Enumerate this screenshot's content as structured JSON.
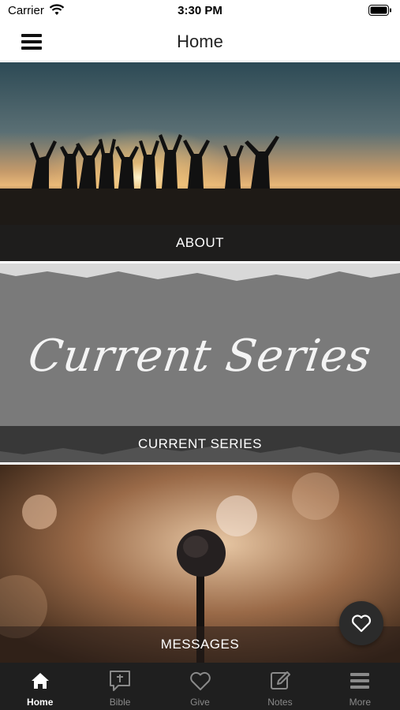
{
  "status_bar": {
    "carrier": "Carrier",
    "time": "3:30 PM"
  },
  "header": {
    "title": "Home"
  },
  "tiles": [
    {
      "label": "ABOUT"
    },
    {
      "label": "CURRENT SERIES",
      "artwork_text": "Current Series"
    },
    {
      "label": "MESSAGES"
    }
  ],
  "tab_bar": {
    "items": [
      {
        "label": "Home",
        "icon": "home-icon",
        "active": true
      },
      {
        "label": "Bible",
        "icon": "bible-icon",
        "active": false
      },
      {
        "label": "Give",
        "icon": "heart-icon",
        "active": false
      },
      {
        "label": "Notes",
        "icon": "notes-icon",
        "active": false
      },
      {
        "label": "More",
        "icon": "more-icon",
        "active": false
      }
    ]
  },
  "colors": {
    "tab_bar_bg": "#1f1f1f",
    "active_tab": "#ffffff",
    "inactive_tab": "#8a8a8a",
    "fab_bg": "#2b2b2b"
  }
}
